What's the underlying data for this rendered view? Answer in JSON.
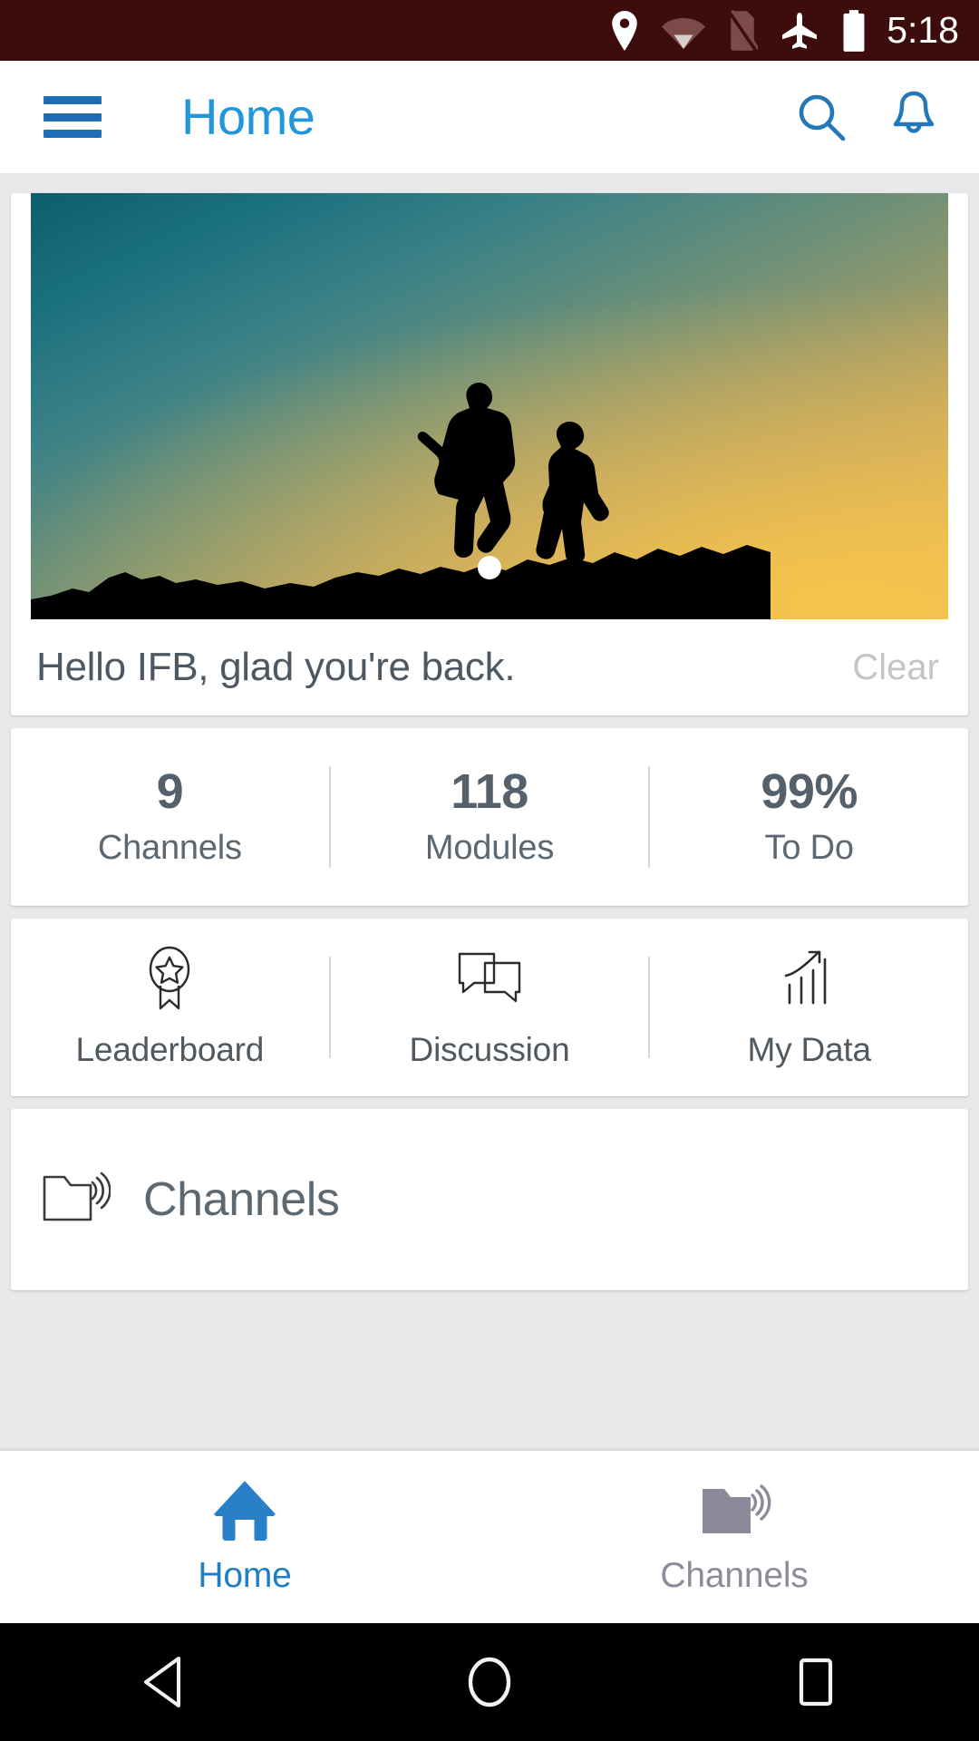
{
  "status_bar": {
    "time": "5:18",
    "icons": [
      "location-pin-icon",
      "wifi-icon",
      "no-sim-icon",
      "airplane-mode-icon",
      "battery-icon"
    ],
    "background_color": "#3d0d0d"
  },
  "app_bar": {
    "menu_icon": "hamburger-menu-icon",
    "title": "Home",
    "search_icon": "search-icon",
    "notifications_icon": "bell-icon",
    "accent_color": "#2196d9",
    "menu_color": "#1f6eb5"
  },
  "hero": {
    "image_description": "silhouette-of-two-children-running-at-sunset",
    "carousel_current_dot": 1,
    "greeting": "Hello IFB, glad you're back.",
    "clear_label": "Clear"
  },
  "stats": [
    {
      "value": "9",
      "label": "Channels"
    },
    {
      "value": "118",
      "label": "Modules"
    },
    {
      "value": "99%",
      "label": "To Do"
    }
  ],
  "quick_actions": [
    {
      "label": "Leaderboard",
      "icon": "award-ribbon-star-icon"
    },
    {
      "label": "Discussion",
      "icon": "chat-bubbles-icon"
    },
    {
      "label": "My Data",
      "icon": "bar-chart-arrow-icon"
    }
  ],
  "channels_section": {
    "title": "Channels",
    "icon": "folder-broadcast-icon"
  },
  "bottom_nav": [
    {
      "label": "Home",
      "icon": "home-icon",
      "active": true,
      "color": "#1f7fc4"
    },
    {
      "label": "Channels",
      "icon": "folder-broadcast-icon",
      "active": false,
      "color": "#8d8d99"
    }
  ],
  "android_nav": {
    "back_icon": "back-triangle-icon",
    "home_icon": "home-circle-icon",
    "recents_icon": "recents-square-icon"
  }
}
